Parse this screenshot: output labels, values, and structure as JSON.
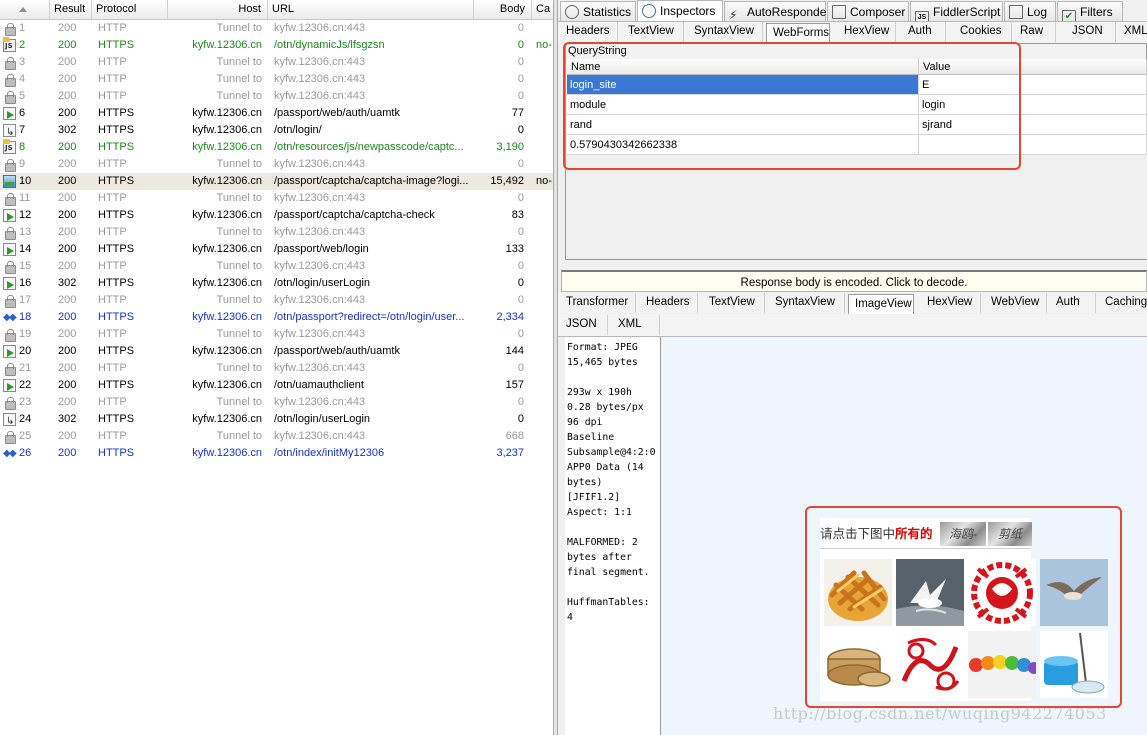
{
  "session_list": {
    "columns": [
      "",
      "Result",
      "Protocol",
      "Host",
      "URL",
      "Body",
      "Ca"
    ],
    "rows": [
      {
        "num": "1",
        "result": "200",
        "protocol": "HTTP",
        "host": "Tunnel to",
        "url": "kyfw.12306.cn:443",
        "body": "0",
        "ca": "",
        "icon": "lock-icon",
        "status": "grey"
      },
      {
        "num": "2",
        "result": "200",
        "protocol": "HTTPS",
        "host": "kyfw.12306.cn",
        "url": "/otn/dynamicJs/lfsgzsn",
        "body": "0",
        "ca": "no-",
        "icon": "js-icon",
        "status": "green"
      },
      {
        "num": "3",
        "result": "200",
        "protocol": "HTTP",
        "host": "Tunnel to",
        "url": "kyfw.12306.cn:443",
        "body": "0",
        "ca": "",
        "icon": "lock-icon",
        "status": "grey"
      },
      {
        "num": "4",
        "result": "200",
        "protocol": "HTTP",
        "host": "Tunnel to",
        "url": "kyfw.12306.cn:443",
        "body": "0",
        "ca": "",
        "icon": "lock-icon",
        "status": "grey"
      },
      {
        "num": "5",
        "result": "200",
        "protocol": "HTTP",
        "host": "Tunnel to",
        "url": "kyfw.12306.cn:443",
        "body": "0",
        "ca": "",
        "icon": "lock-icon",
        "status": "grey"
      },
      {
        "num": "6",
        "result": "200",
        "protocol": "HTTPS",
        "host": "kyfw.12306.cn",
        "url": "/passport/web/auth/uamtk",
        "body": "77",
        "ca": "",
        "icon": "response-icon",
        "status": "black"
      },
      {
        "num": "7",
        "result": "302",
        "protocol": "HTTPS",
        "host": "kyfw.12306.cn",
        "url": "/otn/login/",
        "body": "0",
        "ca": "",
        "icon": "redirect-icon",
        "status": "black"
      },
      {
        "num": "8",
        "result": "200",
        "protocol": "HTTPS",
        "host": "kyfw.12306.cn",
        "url": "/otn/resources/js/newpasscode/captc...",
        "body": "3,190",
        "ca": "",
        "icon": "js-icon",
        "status": "green"
      },
      {
        "num": "9",
        "result": "200",
        "protocol": "HTTP",
        "host": "Tunnel to",
        "url": "kyfw.12306.cn:443",
        "body": "0",
        "ca": "",
        "icon": "lock-icon",
        "status": "grey"
      },
      {
        "num": "10",
        "result": "200",
        "protocol": "HTTPS",
        "host": "kyfw.12306.cn",
        "url": "/passport/captcha/captcha-image?logi...",
        "body": "15,492",
        "ca": "no-",
        "icon": "image-icon",
        "status": "black"
      },
      {
        "num": "11",
        "result": "200",
        "protocol": "HTTP",
        "host": "Tunnel to",
        "url": "kyfw.12306.cn:443",
        "body": "0",
        "ca": "",
        "icon": "lock-icon",
        "status": "grey"
      },
      {
        "num": "12",
        "result": "200",
        "protocol": "HTTPS",
        "host": "kyfw.12306.cn",
        "url": "/passport/captcha/captcha-check",
        "body": "83",
        "ca": "",
        "icon": "response-icon",
        "status": "black"
      },
      {
        "num": "13",
        "result": "200",
        "protocol": "HTTP",
        "host": "Tunnel to",
        "url": "kyfw.12306.cn:443",
        "body": "0",
        "ca": "",
        "icon": "lock-icon",
        "status": "grey"
      },
      {
        "num": "14",
        "result": "200",
        "protocol": "HTTPS",
        "host": "kyfw.12306.cn",
        "url": "/passport/web/login",
        "body": "133",
        "ca": "",
        "icon": "response-icon",
        "status": "black"
      },
      {
        "num": "15",
        "result": "200",
        "protocol": "HTTP",
        "host": "Tunnel to",
        "url": "kyfw.12306.cn:443",
        "body": "0",
        "ca": "",
        "icon": "lock-icon",
        "status": "grey"
      },
      {
        "num": "16",
        "result": "302",
        "protocol": "HTTPS",
        "host": "kyfw.12306.cn",
        "url": "/otn/login/userLogin",
        "body": "0",
        "ca": "",
        "icon": "response-icon",
        "status": "black"
      },
      {
        "num": "17",
        "result": "200",
        "protocol": "HTTP",
        "host": "Tunnel to",
        "url": "kyfw.12306.cn:443",
        "body": "0",
        "ca": "",
        "icon": "lock-icon",
        "status": "grey"
      },
      {
        "num": "18",
        "result": "200",
        "protocol": "HTTPS",
        "host": "kyfw.12306.cn",
        "url": "/otn/passport?redirect=/otn/login/user...",
        "body": "2,334",
        "ca": "",
        "icon": "arrows-icon",
        "status": "blue"
      },
      {
        "num": "19",
        "result": "200",
        "protocol": "HTTP",
        "host": "Tunnel to",
        "url": "kyfw.12306.cn:443",
        "body": "0",
        "ca": "",
        "icon": "lock-icon",
        "status": "grey"
      },
      {
        "num": "20",
        "result": "200",
        "protocol": "HTTPS",
        "host": "kyfw.12306.cn",
        "url": "/passport/web/auth/uamtk",
        "body": "144",
        "ca": "",
        "icon": "response-icon",
        "status": "black"
      },
      {
        "num": "21",
        "result": "200",
        "protocol": "HTTP",
        "host": "Tunnel to",
        "url": "kyfw.12306.cn:443",
        "body": "0",
        "ca": "",
        "icon": "lock-icon",
        "status": "grey"
      },
      {
        "num": "22",
        "result": "200",
        "protocol": "HTTPS",
        "host": "kyfw.12306.cn",
        "url": "/otn/uamauthclient",
        "body": "157",
        "ca": "",
        "icon": "response-icon",
        "status": "black"
      },
      {
        "num": "23",
        "result": "200",
        "protocol": "HTTP",
        "host": "Tunnel to",
        "url": "kyfw.12306.cn:443",
        "body": "0",
        "ca": "",
        "icon": "lock-icon",
        "status": "grey"
      },
      {
        "num": "24",
        "result": "302",
        "protocol": "HTTPS",
        "host": "kyfw.12306.cn",
        "url": "/otn/login/userLogin",
        "body": "0",
        "ca": "",
        "icon": "redirect-icon",
        "status": "black"
      },
      {
        "num": "25",
        "result": "200",
        "protocol": "HTTP",
        "host": "Tunnel to",
        "url": "kyfw.12306.cn:443",
        "body": "668",
        "ca": "",
        "icon": "lock-icon",
        "status": "grey"
      },
      {
        "num": "26",
        "result": "200",
        "protocol": "HTTPS",
        "host": "kyfw.12306.cn",
        "url": "/otn/index/initMy12306",
        "body": "3,237",
        "ca": "",
        "icon": "arrows-icon",
        "status": "blue"
      }
    ],
    "selected_row": 10
  },
  "main_tabs": [
    {
      "label": "Statistics",
      "icon": "stopwatch-icon"
    },
    {
      "label": "Inspectors",
      "icon": "magnifier-icon"
    },
    {
      "label": "AutoResponder",
      "icon": "lightning-icon"
    },
    {
      "label": "Composer",
      "icon": "pencil-icon"
    },
    {
      "label": "FiddlerScript",
      "icon": "js-icon"
    },
    {
      "label": "Log",
      "icon": "log-icon"
    },
    {
      "label": "Filters",
      "icon": "checkbox-icon"
    }
  ],
  "request_tabs": [
    "Headers",
    "TextView",
    "SyntaxView",
    "WebForms",
    "HexView",
    "Auth",
    "Cookies",
    "Raw",
    "JSON",
    "XML"
  ],
  "request_active_tab": "WebForms",
  "querystring": {
    "title": "QueryString",
    "headers": [
      "Name",
      "Value"
    ],
    "rows": [
      {
        "name": "login_site",
        "value": "E"
      },
      {
        "name": "module",
        "value": "login"
      },
      {
        "name": "rand",
        "value": "sjrand"
      },
      {
        "name": "0.5790430342662338",
        "value": ""
      }
    ]
  },
  "response_notice": "Response body is encoded. Click to decode.",
  "response_tabs_row1": [
    "Transformer",
    "Headers",
    "TextView",
    "SyntaxView",
    "ImageView",
    "HexView",
    "WebView",
    "Auth",
    "Caching"
  ],
  "response_tabs_row2": [
    "JSON",
    "XML"
  ],
  "response_active_tab": "ImageView",
  "image_meta": "Format: JPEG\n15,465 bytes\n\n293w x 190h\n0.28 bytes/px\n96 dpi\nBaseline\nSubsample@4:2:0\nAPP0 Data (14\nbytes)\n[JFIF1.2]\nAspect: 1:1\n\nMALFORMED: 2\nbytes after\nfinal segment.\n\nHuffmanTables:\n4",
  "captcha": {
    "prompt": "请点击下图中",
    "emphasis": "所有的",
    "words": [
      "海鸥-",
      "剪纸"
    ],
    "images": [
      "fries",
      "seagull-water",
      "paper-cut",
      "seagull-flying",
      "steamer",
      "red-pattern",
      "beads",
      "mop-bucket"
    ]
  },
  "watermark": "http://blog.csdn.net/wuqing942274053"
}
